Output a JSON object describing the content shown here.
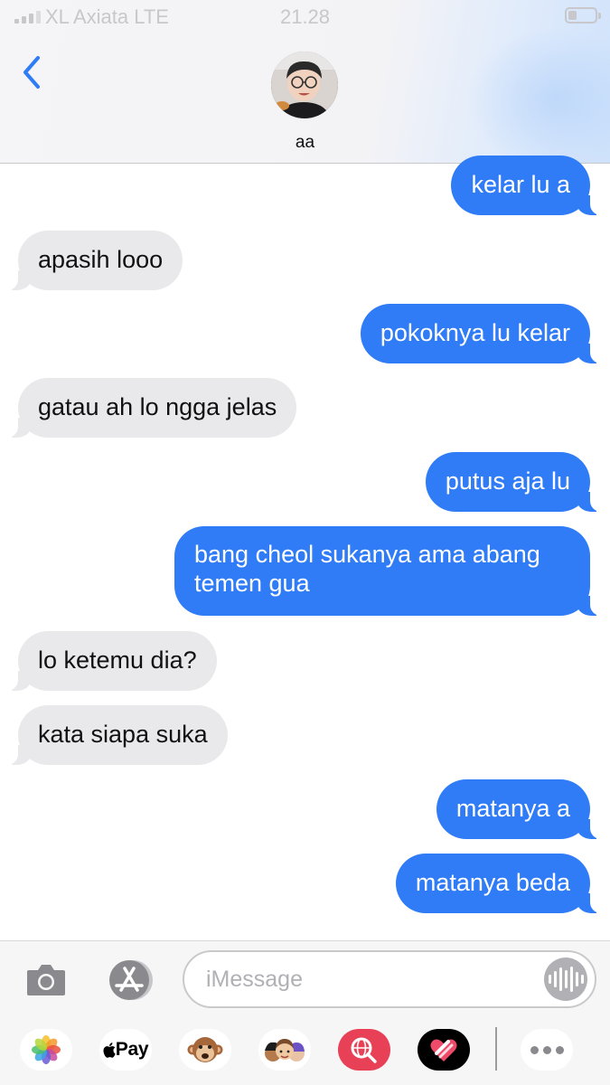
{
  "status_bar": {
    "carrier": "XL Axiata  LTE",
    "time": "21.28"
  },
  "header": {
    "back_icon": "chevron-left-icon",
    "contact_name": "aa"
  },
  "messages": [
    {
      "side": "sent",
      "text": "kelar lu a"
    },
    {
      "side": "received",
      "text": "apasih looo"
    },
    {
      "side": "sent",
      "text": "pokoknya lu kelar"
    },
    {
      "side": "received",
      "text": "gatau ah lo ngga jelas"
    },
    {
      "side": "sent",
      "text": "putus aja lu"
    },
    {
      "side": "sent",
      "text": "bang cheol sukanya ama abang temen gua"
    },
    {
      "side": "received",
      "text": "lo ketemu dia?"
    },
    {
      "side": "received",
      "text": "kata siapa suka"
    },
    {
      "side": "sent",
      "text": "matanya a"
    },
    {
      "side": "sent",
      "text": "matanya beda"
    }
  ],
  "composer": {
    "placeholder": "iMessage"
  },
  "app_drawer": {
    "apps": [
      "photos-icon",
      "apple-pay",
      "monkey-animoji-icon",
      "memoji-stickers-icon",
      "web-search-icon",
      "digital-touch-icon",
      "more-icon"
    ],
    "apple_pay_label": "Pay"
  },
  "colors": {
    "sent_bubble": "#2f7cf6",
    "received_bubble": "#e9e9eb",
    "accent": "#2f7cf6"
  }
}
